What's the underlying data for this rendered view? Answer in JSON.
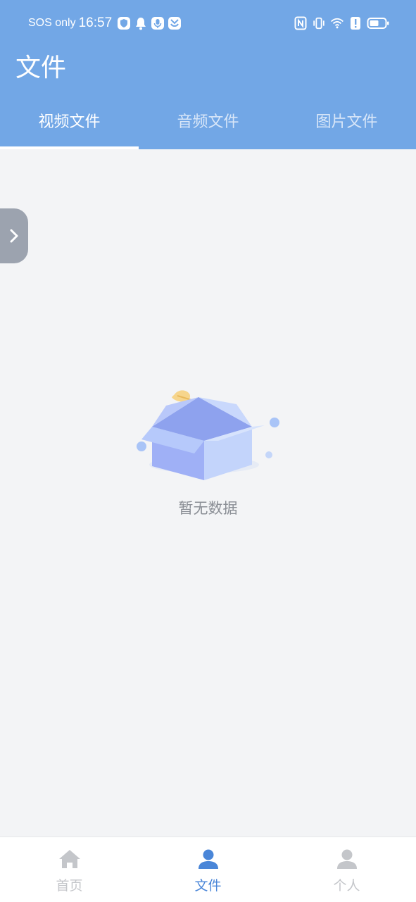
{
  "status_bar": {
    "carrier": "SOS only",
    "time": "16:57",
    "left_icons": [
      "shield-app-icon",
      "bell-icon",
      "microphone-icon",
      "app-icon"
    ],
    "right_icons": [
      "nfc-icon",
      "vibrate-icon",
      "wifi-icon",
      "alert-icon",
      "battery-icon"
    ]
  },
  "header": {
    "title": "文件",
    "background_color": "#72a7e6"
  },
  "tabs": [
    {
      "label": "视频文件",
      "active": true
    },
    {
      "label": "音频文件",
      "active": false
    },
    {
      "label": "图片文件",
      "active": false
    }
  ],
  "side_handle": {
    "icon": "chevron-right-icon"
  },
  "empty_state": {
    "icon": "empty-box-icon",
    "text": "暂无数据"
  },
  "bottom_nav": {
    "items": [
      {
        "label": "首页",
        "icon": "home-icon",
        "active": false
      },
      {
        "label": "文件",
        "icon": "user-icon",
        "active": true
      },
      {
        "label": "个人",
        "icon": "person-icon",
        "active": false
      }
    ],
    "active_color": "#4a86d8",
    "inactive_color": "#c4c6ca"
  }
}
